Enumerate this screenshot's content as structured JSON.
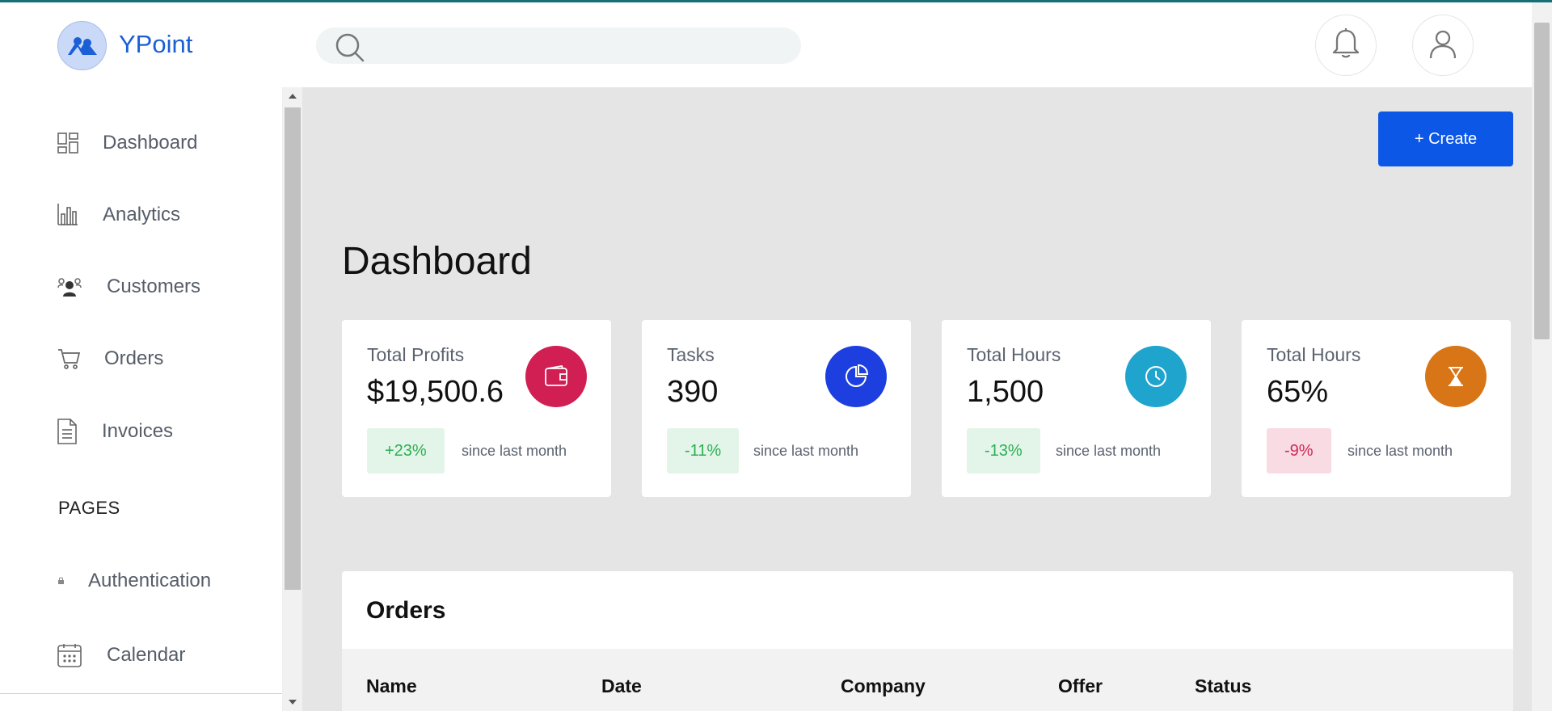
{
  "app": {
    "name": "YPoint"
  },
  "search": {
    "placeholder": ""
  },
  "sidebar": {
    "items": [
      {
        "label": "Dashboard",
        "icon": "dashboard-icon"
      },
      {
        "label": "Analytics",
        "icon": "bar-chart-icon"
      },
      {
        "label": "Customers",
        "icon": "users-icon"
      },
      {
        "label": "Orders",
        "icon": "cart-icon"
      },
      {
        "label": "Invoices",
        "icon": "document-icon"
      }
    ],
    "section_title": "PAGES",
    "pages": [
      {
        "label": "Authentication",
        "icon": "lock-icon"
      },
      {
        "label": "Calendar",
        "icon": "calendar-icon"
      }
    ]
  },
  "main": {
    "create_label": "+ Create",
    "title": "Dashboard",
    "cards": [
      {
        "label": "Total Profits",
        "value": "$19,500.6",
        "change": "+23%",
        "note": "since last month",
        "icon": "wallet-icon",
        "color": "#d11f54"
      },
      {
        "label": "Tasks",
        "value": "390",
        "change": "-11%",
        "note": "since last month",
        "icon": "pie-chart-icon",
        "color": "#1d3fe0"
      },
      {
        "label": "Total Hours",
        "value": "1,500",
        "change": "-13%",
        "note": "since last month",
        "icon": "clock-icon",
        "color": "#1fa4cd"
      },
      {
        "label": "Total Hours",
        "value": "65%",
        "change": "-9%",
        "note": "since last month",
        "icon": "hourglass-icon",
        "color": "#d87516"
      }
    ],
    "orders": {
      "title": "Orders",
      "columns": [
        "Name",
        "Date",
        "Company",
        "Offer",
        "Status"
      ]
    }
  }
}
